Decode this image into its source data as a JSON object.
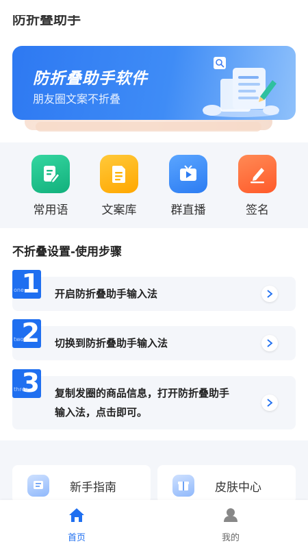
{
  "top_partial_text": "防折叠助手",
  "banner": {
    "title": "防折叠助手软件",
    "subtitle": "朋友圈文案不折叠"
  },
  "shortcuts": [
    {
      "label": "常用语",
      "icon": "edit-doc-icon",
      "color": "#1fc48e"
    },
    {
      "label": "文案库",
      "icon": "document-icon",
      "color": "#ffb300"
    },
    {
      "label": "群直播",
      "icon": "tv-play-icon",
      "color": "#3d8ef8"
    },
    {
      "label": "签名",
      "icon": "pen-sign-icon",
      "color": "#ff6a3d"
    }
  ],
  "steps": {
    "title": "不折叠设置-使用步骤",
    "items": [
      {
        "num": "1",
        "word": "one",
        "text": "开启防折叠助手输入法"
      },
      {
        "num": "2",
        "word": "two",
        "text": "切换到防折叠助手输入法"
      },
      {
        "num": "3",
        "word": "three",
        "line1": "复制发圈的商品信息，打开防折叠助手",
        "line2": "输入法，点击即可。"
      }
    ]
  },
  "cards": [
    {
      "label": "新手指南",
      "icon": "guide-icon"
    },
    {
      "label": "皮肤中心",
      "icon": "gift-icon"
    }
  ],
  "tabbar": {
    "home": "首页",
    "mine": "我的",
    "active_color": "#1f6ff0",
    "inactive_color": "#666666"
  }
}
